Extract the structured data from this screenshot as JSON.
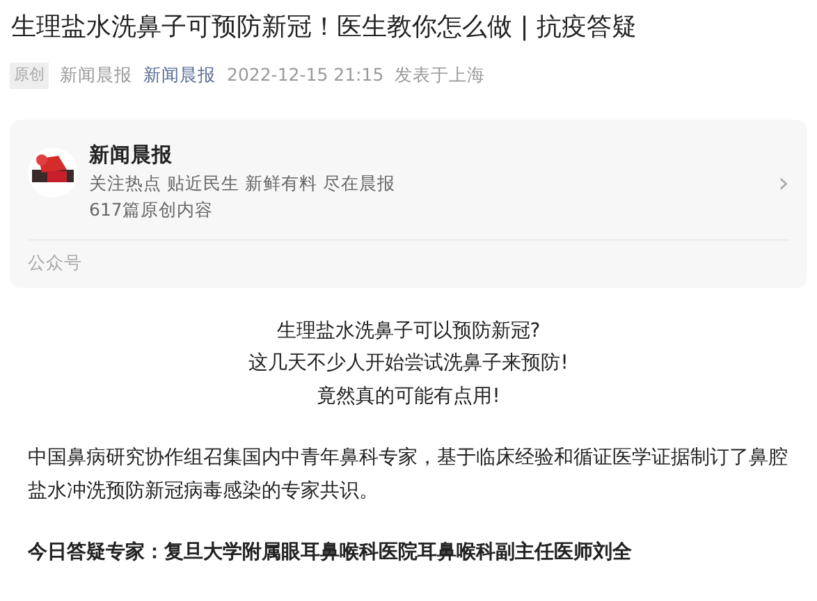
{
  "title": "生理盐水洗鼻子可预防新冠！医生教你怎么做 | 抗疫答疑",
  "meta": {
    "badge": "原创",
    "author": "新闻晨报",
    "account": "新闻晨报",
    "datetime": "2022-12-15 21:15",
    "location": "发表于上海"
  },
  "profile_card": {
    "name": "新闻晨报",
    "description": "关注热点 贴近民生 新鲜有料 尽在晨报",
    "count": "617篇原创内容",
    "chevron": "›",
    "footer": "公众号"
  },
  "intro_lines": [
    "生理盐水洗鼻子可以预防新冠?",
    "这几天不少人开始尝试洗鼻子来预防!",
    "竟然真的可能有点用!"
  ],
  "paragraphs": [
    {
      "kind": "normal",
      "text": "中国鼻病研究协作组召集国内中青年鼻科专家，基于临床经验和循证医学证据制订了鼻腔盐水冲洗预防新冠病毒感染的专家共识。"
    },
    {
      "kind": "bold",
      "text": "今日答疑专家：复旦大学附属眼耳鼻喉科医院耳鼻喉科副主任医师刘全"
    }
  ]
}
